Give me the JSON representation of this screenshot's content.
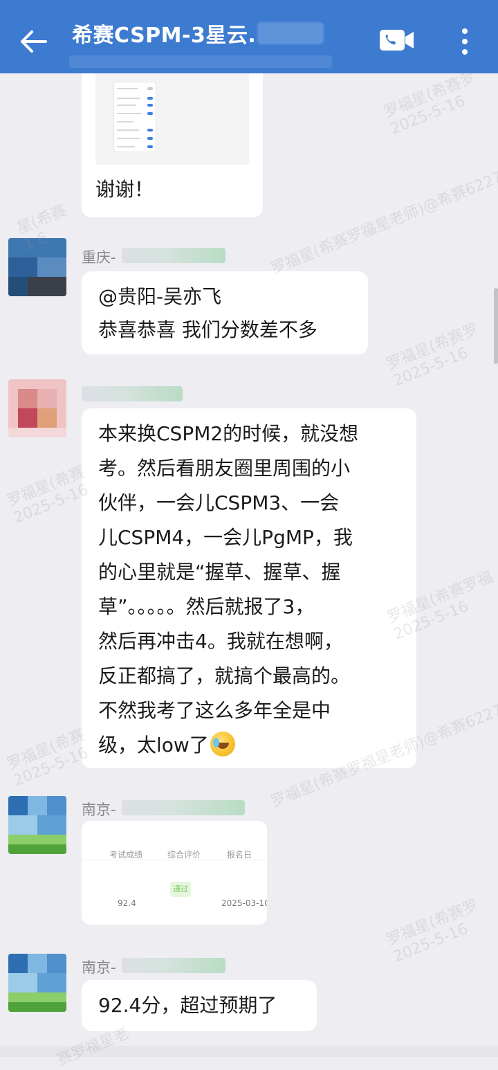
{
  "header": {
    "title": "希赛CSPM-3星云.",
    "icons": {
      "back": "back-arrow-icon",
      "call": "video-call-icon",
      "more": "more-vertical-icon"
    },
    "color": "#3d7bd0"
  },
  "messages": [
    {
      "type": "image_with_text",
      "text": "谢谢！"
    },
    {
      "sender": "重庆-",
      "lines": [
        "@贵阳-吴亦飞",
        "恭喜恭喜 我们分数差不多"
      ]
    },
    {
      "sender": "",
      "lines": [
        "本来换CSPM2的时候，就没想",
        "考。然后看朋友圈里周围的小",
        "伙伴，一会儿CSPM3、一会",
        "儿CSPM4，一会儿PgMP，我",
        "的心里就是“握草、握草、握",
        "草”。。。。。然后就报了3，",
        "然后再冲击4。我就在想啊，",
        "反正都搞了，就搞个最高的。",
        "不然我考了这么多年全是中",
        "级，太low了"
      ],
      "emoji": "crying-laughing-emoji-icon"
    },
    {
      "sender": "南京-",
      "table": {
        "headers": [
          "考试成绩",
          "综合评价",
          "报名日"
        ],
        "row": [
          "92.4",
          "通过",
          "2025-03-10"
        ]
      }
    },
    {
      "sender": "南京-",
      "lines": [
        "92.4分，超过预期了"
      ]
    }
  ],
  "watermarks": [
    "罗福星(希赛罗\n2025-5-16",
    "星(希赛\n1 6",
    "罗福星(希赛罗福星老师)@希赛6227",
    "罗福星(希赛罗\n2025-5-16",
    "罗福星(希赛\n2025-5-16",
    "罗福星(希赛罗福\n2025-5-16",
    "罗福星(希赛罗福星老师)@希赛6227",
    "罗福星(希赛\n2025-5-16",
    "罗福星(希赛罗\n2025-5-16",
    "赛罗福星老"
  ]
}
